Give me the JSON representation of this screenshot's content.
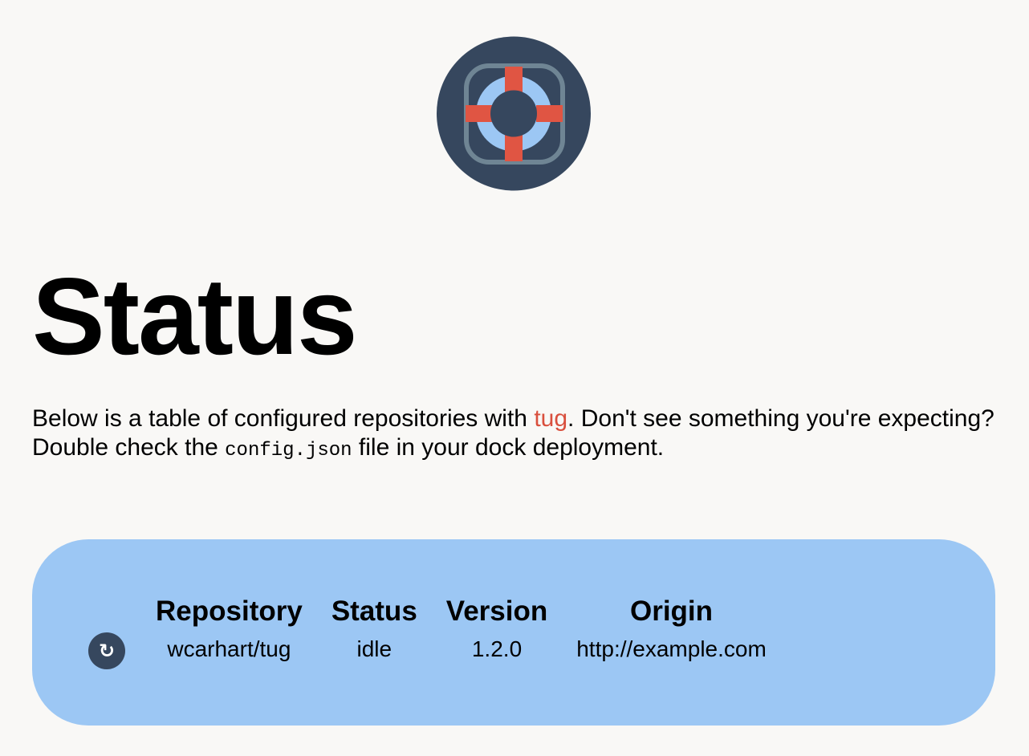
{
  "logo": {
    "icon": "life-ring-icon",
    "colors": {
      "disc": "#36475e",
      "ring": "#9cc7f4",
      "stripes": "#e05543",
      "rope": "#6f8594"
    }
  },
  "page": {
    "title": "Status",
    "intro": {
      "before_link": "Below is a table of configured repositories with ",
      "link_text": "tug",
      "after_link": ". Don't see something you're expecting? Double check the ",
      "code": "config.json",
      "end": " file in your dock deployment."
    }
  },
  "table": {
    "headers": [
      "Repository",
      "Status",
      "Version",
      "Origin"
    ],
    "rows": [
      {
        "action_icon": "refresh-icon",
        "action_glyph": "↻",
        "repository": "wcarhart/tug",
        "status": "idle",
        "version": "1.2.0",
        "origin": "http://example.com"
      }
    ]
  },
  "colors": {
    "background": "#f9f8f6",
    "panel": "#9cc7f4",
    "accent": "#d94f3d",
    "button": "#36475e"
  }
}
